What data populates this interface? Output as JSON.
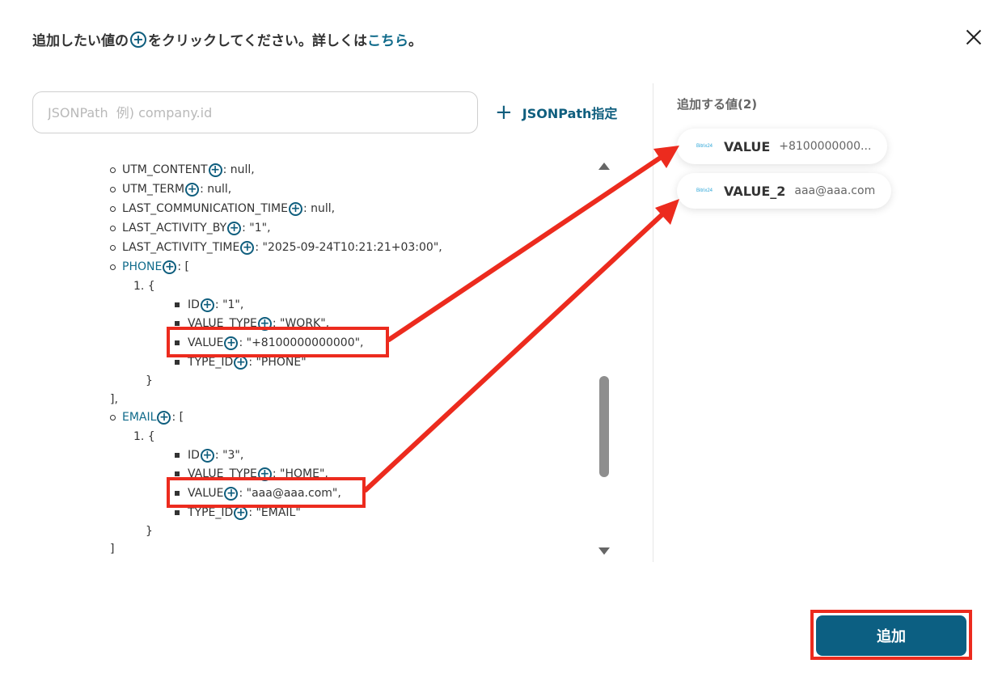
{
  "header": {
    "text_before": "追加したい値の",
    "plus_symbol": "+",
    "text_middle": "をクリックしてください。詳しくは",
    "link_text": "こちら",
    "text_after": "。"
  },
  "search": {
    "placeholder": "JSONPath  例) company.id",
    "value": ""
  },
  "jsonpath_button": {
    "icon": "+",
    "label": "JSONPath指定"
  },
  "tree": {
    "utm_content": "UTM_CONTENT",
    "utm_content_value": ": null,",
    "utm_term": "UTM_TERM",
    "utm_term_value": ": null,",
    "last_comm": "LAST_COMMUNICATION_TIME",
    "last_comm_value": ": null,",
    "last_activity_by": "LAST_ACTIVITY_BY",
    "last_activity_by_value": ": \"1\",",
    "last_activity_time": "LAST_ACTIVITY_TIME",
    "last_activity_time_value": ": \"2025-09-24T10:21:21+03:00\",",
    "phone": "PHONE",
    "open_bracket": ": [",
    "item_num": "1. {",
    "id": "ID",
    "phone_id_value": ": \"1\",",
    "value_type": "VALUE_TYPE",
    "phone_value_type_value": ": \"WORK\",",
    "value": "VALUE",
    "phone_value_value": ": \"+8100000000000\",",
    "type_id": "TYPE_ID",
    "phone_type_id_value": ": \"PHONE\"",
    "close_brace": "}",
    "close_bracket_comma": "],",
    "email": "EMAIL",
    "email_id_value": ": \"3\",",
    "email_value_type_value": ": \"HOME\",",
    "email_value_value": ": \"aaa@aaa.com\",",
    "email_type_id_value": ": \"EMAIL\"",
    "close_bracket": "]"
  },
  "added_values": {
    "title": "追加する値(2)",
    "items": [
      {
        "logo": "Bitrix24",
        "name": "VALUE",
        "value": "+8100000000..."
      },
      {
        "logo": "Bitrix24",
        "name": "VALUE_2",
        "value": "aaa@aaa.com"
      }
    ]
  },
  "add_button": {
    "label": "追加"
  },
  "colors": {
    "accent": "#0c5f82",
    "link": "#0f6a8a",
    "highlight": "#ec2b1e",
    "text": "#333333"
  },
  "icons": [
    "plus-circle-icon",
    "close-icon",
    "plus-icon",
    "scroll-up-icon",
    "scroll-down-icon",
    "bitrix24-logo-icon",
    "arrow-icon"
  ]
}
